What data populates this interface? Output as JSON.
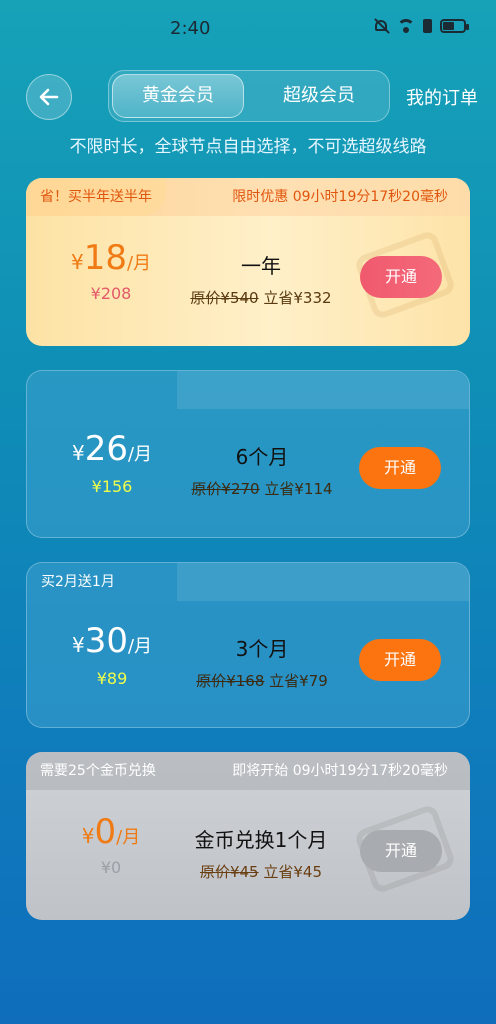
{
  "status": {
    "time": "2:40"
  },
  "header": {
    "tabs": [
      {
        "label": "黄金会员"
      },
      {
        "label": "超级会员"
      }
    ],
    "orders_label": "我的订单"
  },
  "subtitle": "不限时长，全球节点自由选择，不可选超级线路",
  "plans": [
    {
      "tag": "省！买半年送半年",
      "promo": "限时优惠  09小时19分17秒20毫秒",
      "currency": "¥",
      "price": "18",
      "unit": "/月",
      "total": "¥208",
      "name": "一年",
      "orig_label": "原价",
      "orig": "¥540",
      "save": "立省¥332",
      "button": "开通"
    },
    {
      "tag": "",
      "promo": "",
      "currency": "¥",
      "price": "26",
      "unit": "/月",
      "total": "¥156",
      "name": "6个月",
      "orig_label": "原价",
      "orig": "¥270",
      "save": "立省¥114",
      "button": "开通"
    },
    {
      "tag": "买2月送1月",
      "promo": "",
      "currency": "¥",
      "price": "30",
      "unit": "/月",
      "total": "¥89",
      "name": "3个月",
      "orig_label": "原价",
      "orig": "¥168",
      "save": "立省¥79",
      "button": "开通"
    },
    {
      "tag": "需要25个金币兑换",
      "promo": "即将开始  09小时19分17秒20毫秒",
      "currency": "¥",
      "price": "0",
      "unit": "/月",
      "total": "¥0",
      "name": "金币兑换1个月",
      "orig_label": "原价",
      "orig": "¥45",
      "save": "立省¥45",
      "button": "开通"
    }
  ],
  "colors": {
    "accent_orange": "#fb7410",
    "pink_button": "#f0596e",
    "gold_card": "#fde2a4"
  }
}
